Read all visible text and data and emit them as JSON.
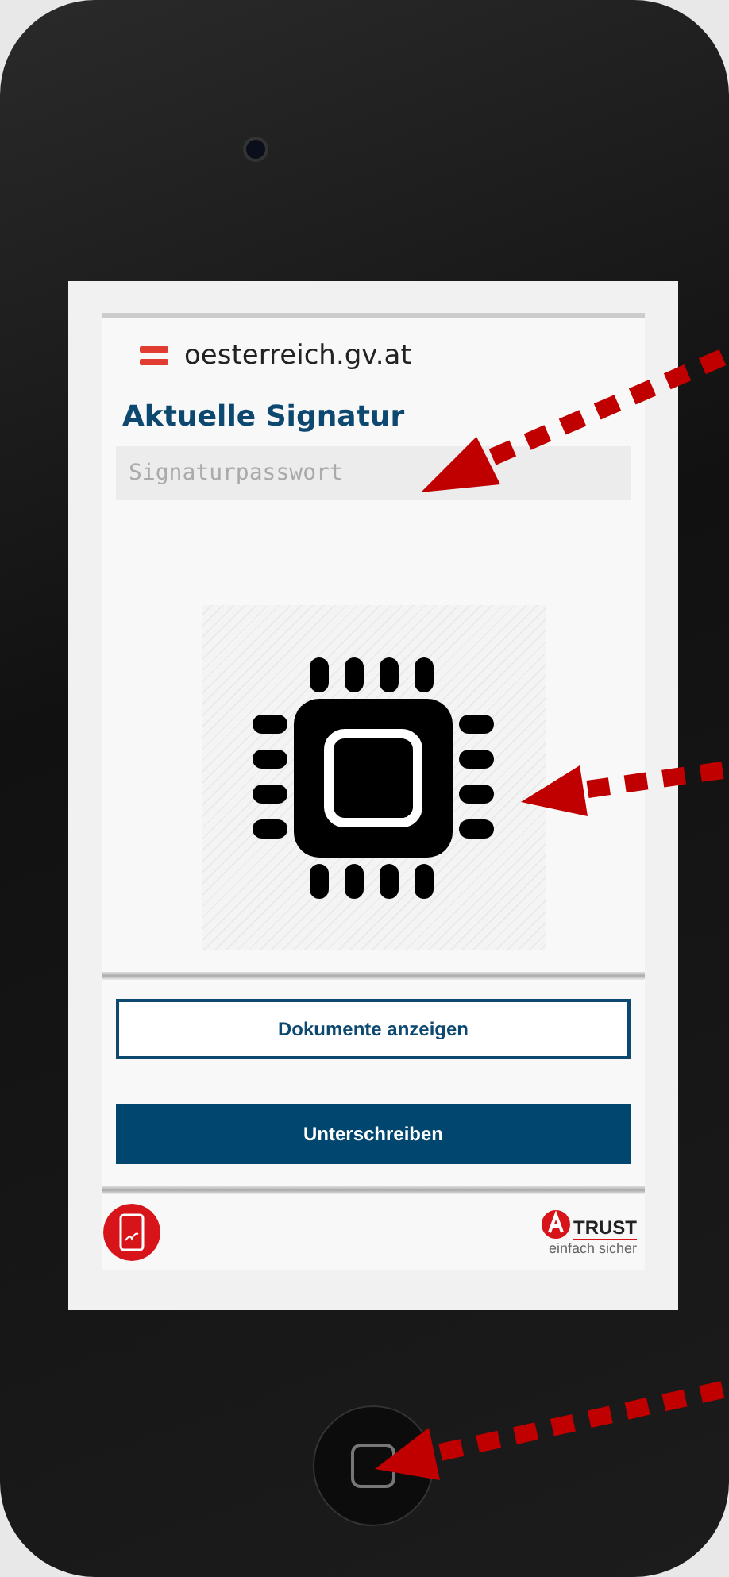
{
  "header": {
    "site": "oesterreich.gv.at"
  },
  "title": "Aktuelle Signatur",
  "password_field": {
    "placeholder": "Signaturpasswort"
  },
  "buttons": [
    {
      "label": "Dokumente anzeigen",
      "kind": "outline"
    },
    {
      "label": "Unterschreiben",
      "kind": "filled"
    }
  ],
  "footer": {
    "brand": "TRUST",
    "slogan": "einfach sicher"
  }
}
